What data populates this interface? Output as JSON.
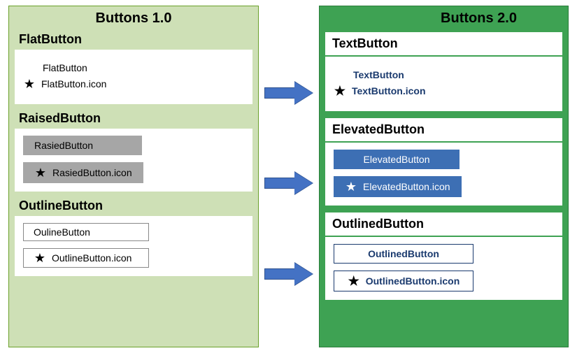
{
  "left": {
    "title": "Buttons 1.0",
    "groups": {
      "flat": {
        "title": "FlatButton",
        "plain": "FlatButton",
        "icon": "FlatButton.icon"
      },
      "raised": {
        "title": "RaisedButton",
        "plain": "RasiedButton",
        "icon": "RasiedButton.icon"
      },
      "outline": {
        "title": "OutlineButton",
        "plain": "OulineButton",
        "icon": "OutlineButton.icon"
      }
    }
  },
  "right": {
    "title": "Buttons 2.0",
    "groups": {
      "text": {
        "title": "TextButton",
        "plain": "TextButton",
        "icon": "TextButton.icon"
      },
      "elevated": {
        "title": "ElevatedButton",
        "plain": "ElevatedButton",
        "icon": "ElevatedButton.icon"
      },
      "outlined": {
        "title": "OutlinedButton",
        "plain": "OutlinedButton",
        "icon": "OutlinedButton.icon"
      }
    }
  },
  "icons": {
    "star": "★"
  },
  "colors": {
    "left_bg": "#cee0b6",
    "right_bg": "#3ea253",
    "arrow": "#4472c4",
    "elevated": "#3d6fb4",
    "navy_text": "#1a3a6e",
    "raised_grey": "#a6a6a6"
  }
}
